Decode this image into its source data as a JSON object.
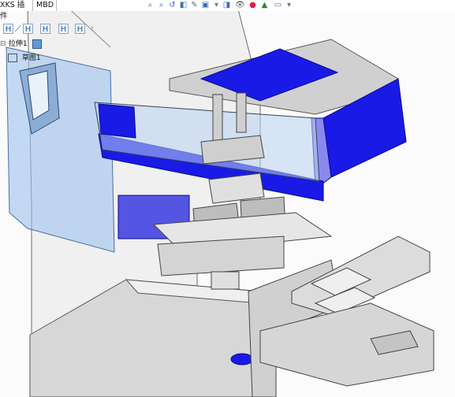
{
  "tabs": [
    {
      "label": "XKS 插件"
    },
    {
      "label": "MBD"
    }
  ],
  "heads_up_toolbar": {
    "icons": [
      "zoom-to-fit-icon",
      "zoom-to-area-icon",
      "previous-view-icon",
      "section-view-icon",
      "dynamic-annotation-icon",
      "view-orientation-icon",
      "display-style-icon",
      "hide-show-items-icon",
      "edit-appearance-icon",
      "apply-scene-icon",
      "view-settings-icon"
    ]
  },
  "cmd_buttons": [
    "H",
    "H",
    "H",
    "H",
    "H"
  ],
  "feature_tree": {
    "feature_label": "拉伸1",
    "sketch_label": "草图1"
  },
  "colors": {
    "accent_blue": "#1a1ae6",
    "glass_blue": "#9fc3ee",
    "metal_gray": "#cfcfcf"
  }
}
